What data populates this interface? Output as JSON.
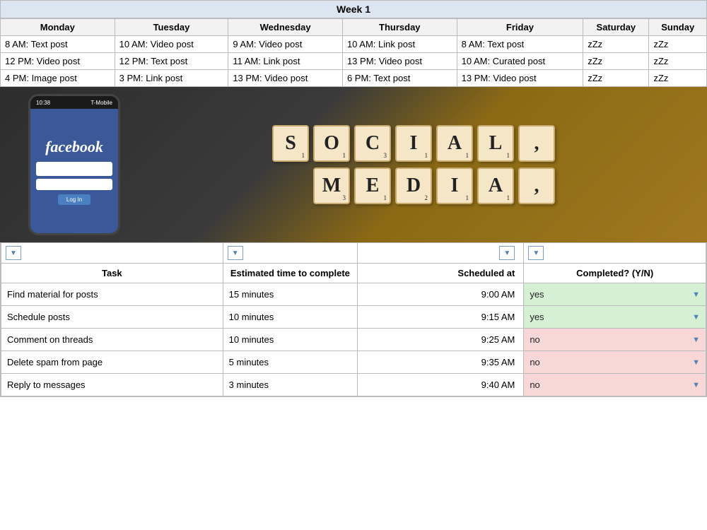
{
  "weekHeader": "Week 1",
  "schedule": {
    "days": [
      "Monday",
      "Tuesday",
      "Wednesday",
      "Thursday",
      "Friday",
      "Saturday",
      "Sunday"
    ],
    "rows": [
      [
        "8 AM: Text post",
        "10 AM: Video post",
        "9 AM: Video post",
        "10 AM: Link post",
        "8 AM: Text post",
        "zZz",
        "zZz"
      ],
      [
        "12 PM: Video post",
        "12 PM: Text post",
        "11 AM: Link post",
        "13 PM: Video post",
        "10 AM: Curated post",
        "zZz",
        "zZz"
      ],
      [
        "4 PM: Image post",
        "3 PM: Link post",
        "13 PM: Video post",
        "6 PM: Text post",
        "13 PM: Video post",
        "zZz",
        "zZz"
      ]
    ]
  },
  "scrabble": {
    "row1": [
      {
        "letter": "S",
        "num": "1"
      },
      {
        "letter": "O",
        "num": "1"
      },
      {
        "letter": "C",
        "num": "3"
      },
      {
        "letter": "I",
        "num": "1"
      },
      {
        "letter": "A",
        "num": "1"
      },
      {
        "letter": "L",
        "num": "1"
      },
      {
        "letter": ",",
        "num": ""
      }
    ],
    "row2": [
      {
        "letter": "M",
        "num": "3"
      },
      {
        "letter": "E",
        "num": "1"
      },
      {
        "letter": "D",
        "num": "2"
      },
      {
        "letter": "I",
        "num": "1"
      },
      {
        "letter": "A",
        "num": "1"
      },
      {
        "letter": ",",
        "num": ""
      }
    ]
  },
  "tasks": {
    "filterButtons": [
      "▼",
      "▼",
      "▼",
      "▼"
    ],
    "headers": {
      "task": "Task",
      "time": "Estimated time to complete",
      "scheduled": "Scheduled at",
      "completed": "Completed? (Y/N)"
    },
    "rows": [
      {
        "task": "Find material for posts",
        "time": "15 minutes",
        "scheduled": "9:00 AM",
        "completed": "yes",
        "status": "yes"
      },
      {
        "task": "Schedule posts",
        "time": "10 minutes",
        "scheduled": "9:15 AM",
        "completed": "yes",
        "status": "yes"
      },
      {
        "task": "Comment on threads",
        "time": "10 minutes",
        "scheduled": "9:25 AM",
        "completed": "no",
        "status": "no"
      },
      {
        "task": "Delete spam from page",
        "time": "5 minutes",
        "scheduled": "9:35 AM",
        "completed": "no",
        "status": "no"
      },
      {
        "task": "Reply to messages",
        "time": "3 minutes",
        "scheduled": "9:40 AM",
        "completed": "no",
        "status": "no"
      }
    ]
  }
}
